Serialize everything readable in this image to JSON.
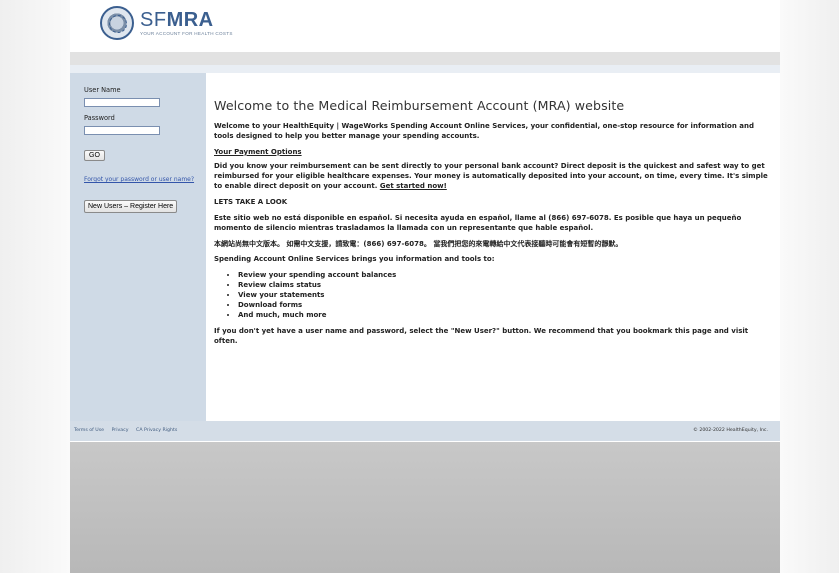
{
  "logo": {
    "brand_prefix": "SF",
    "brand_bold": "MRA",
    "tagline": "YOUR ACCOUNT FOR HEALTH COSTS"
  },
  "login": {
    "username_label": "User Name",
    "username_value": "",
    "password_label": "Password",
    "password_value": "",
    "go_label": "GO",
    "forgot_link": "Forgot your password or user name?",
    "new_users_label": "New Users – Register Here"
  },
  "main": {
    "title": "Welcome to the Medical Reimbursement Account (MRA) website",
    "intro": "Welcome to your HealthEquity | WageWorks Spending Account Online Services, your confidential, one-stop resource for information and tools designed to help you better manage your spending accounts.",
    "payment_options_link": "Your Payment Options",
    "direct_deposit_text": "Did you know your reimbursement can be sent directly to your personal bank account? Direct deposit is the quickest and safest way to get reimbursed for your eligible healthcare expenses. Your money is automatically deposited into your account, on time, every time. It's simple to enable direct deposit on your account.",
    "get_started_link": "Get started now!",
    "lets_take_look": "LETS TAKE A LOOK",
    "spanish_text": "Este sitio web no está disponible en español. Si necesita ayuda en español, llame al (866) 697-6078. Es posible que haya un pequeño momento de silencio mientras trasladamos la llamada con un representante que hable español.",
    "chinese_text": "本網站尚無中文版本。 如需中文支援，請致電：(866) 697-6078。 當我們把您的來電轉給中文代表接聽時可能會有短暫的靜默。",
    "tools_intro": "Spending Account Online Services brings you information and tools to:",
    "tools_list": [
      "Review your spending account balances",
      "Review claims status",
      "View your statements",
      "Download forms",
      "And much, much more"
    ],
    "closing_text": "If you don't yet have a user name and password, select the \"New User?\" button. We recommend that you bookmark this page and visit often."
  },
  "footer": {
    "links": [
      "Terms of Use",
      "Privacy",
      "CA Privacy Rights"
    ],
    "copyright": "© 2002-2022 HealthEquity, Inc."
  },
  "colors": {
    "brand_blue": "#3b5f8f",
    "sidebar_bg": "#cfdae6",
    "link_blue": "#3355aa"
  }
}
